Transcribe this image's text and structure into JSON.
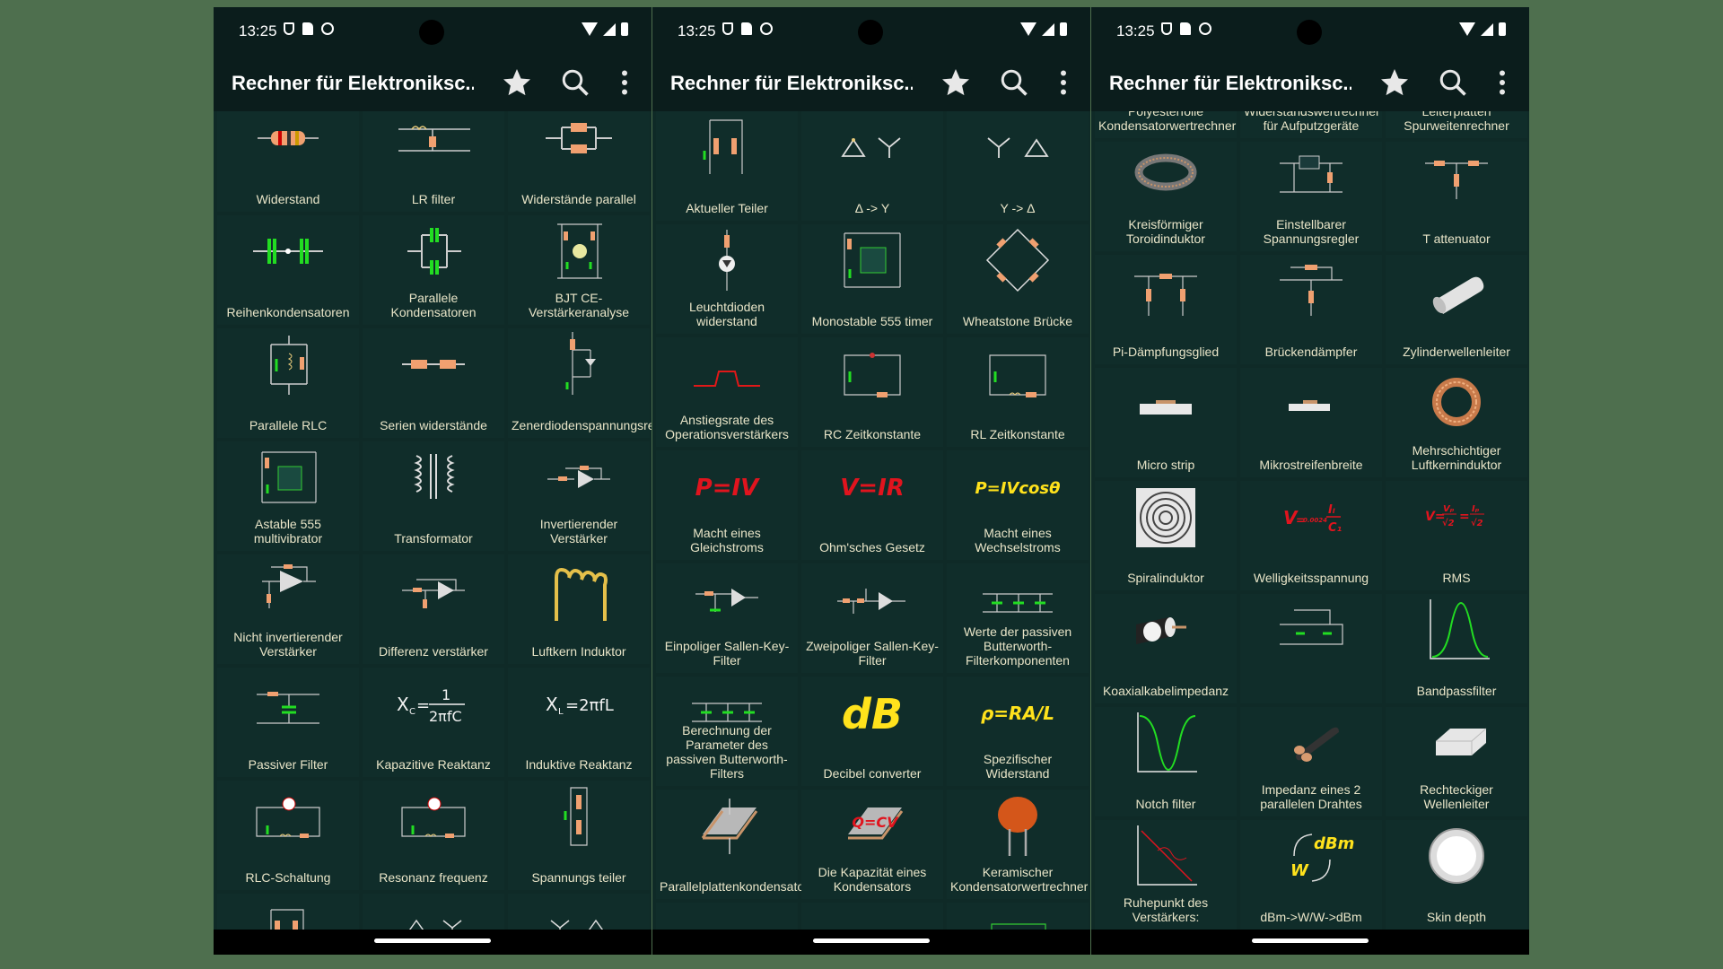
{
  "status": {
    "time": "13:25"
  },
  "app": {
    "title": "Rechner für Elektroniksc..."
  },
  "phones": [
    {
      "tiles": [
        "Widerstand",
        "LR filter",
        "Widerstände parallel",
        "Reihenkondensatoren",
        "Parallele Kondensatoren",
        "BJT CE-Verstärkeranalyse",
        "Parallele RLC",
        "Serien widerstände",
        "Zenerdiodenspannungsregler",
        "Astable 555 multivibrator",
        "Transformator",
        "Invertierender Verstärker",
        "Nicht invertierender Verstärker",
        "Differenz verstärker",
        "Luftkern Induktor",
        "Passiver Filter",
        "Kapazitive Reaktanz",
        "Induktive Reaktanz",
        "RLC-Schaltung",
        "Resonanz frequenz",
        "Spannungs teiler",
        "",
        "",
        ""
      ]
    },
    {
      "tiles": [
        "Aktueller Teiler",
        "Δ -> Y",
        "Y -> Δ",
        "Leuchtdioden widerstand",
        "Monostable 555 timer",
        "Wheatstone Brücke",
        "Anstiegsrate des Operationsverstärkers",
        "RC Zeitkonstante",
        "RL Zeitkonstante",
        "Macht eines Gleichstroms",
        "Ohm'sches Gesetz",
        "Macht eines Wechselstroms",
        "Einpoliger Sallen-Key-Filter",
        "Zweipoliger Sallen-Key-Filter",
        "Werte der passiven Butterworth-Filterkomponenten",
        "Berechnung der Parameter des passiven Butterworth-Filters",
        "Decibel converter",
        "Spezifischer Widerstand",
        "Parallelplattenkondensator",
        "Die Kapazität eines Kondensators",
        "Keramischer Kondensatorwertrechner",
        "",
        "",
        ""
      ]
    },
    {
      "tiles": [
        "Polyesterfolie Kondensatorwertrechner",
        "Widerstandswertrechner für Aufputzgeräte",
        "Leiterplatten Spurweitenrechner",
        "Kreisförmiger Toroidinduktor",
        "Einstellbarer Spannungsregler",
        "T attenuator",
        "Pi-Dämpfungsglied",
        "Brückendämpfer",
        "Zylinderwellenleiter",
        "Micro strip",
        "Mikrostreifenbreite",
        "Mehrschichtiger Luftkerninduktor",
        "Spiralinduktor",
        "Welligkeitsspannung",
        "RMS",
        "Koaxialkabelimpedanz",
        "",
        "Bandpassfilter",
        "Notch filter",
        "Impedanz eines 2 parallelen Drahtes",
        "Rechteckiger Wellenleiter",
        "Ruhepunkt des Verstärkers:",
        "dBm->W/W->dBm",
        "Skin depth"
      ]
    }
  ],
  "formulas": {
    "p_iv": "P=IV",
    "v_ir": "V=IR",
    "p_ivcos": "P=IVcosθ",
    "db": "dB",
    "rho": "ρ=RA/L",
    "q_cv": "Q=CV",
    "dbm": "dBm",
    "w": "W",
    "xc": "Xc=1/2πfC",
    "xl": "XL=2πfL"
  },
  "colors": {
    "accent": "#ffe21c",
    "red": "#e0141e",
    "tile": "#102d2a",
    "bg": "#4e6f4e"
  }
}
